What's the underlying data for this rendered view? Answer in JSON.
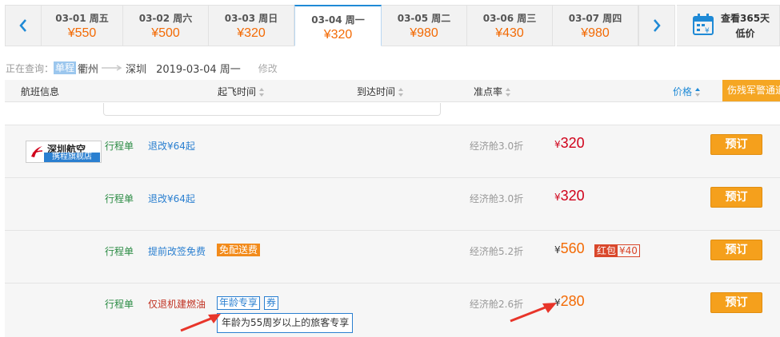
{
  "date_bar": {
    "days": [
      {
        "date": "03-01 周五",
        "price": "¥550"
      },
      {
        "date": "03-02 周六",
        "price": "¥500"
      },
      {
        "date": "03-03 周日",
        "price": "¥320"
      },
      {
        "date": "03-04 周一",
        "price": "¥320",
        "active": true
      },
      {
        "date": "03-05 周二",
        "price": "¥980"
      },
      {
        "date": "03-06 周三",
        "price": "¥430"
      },
      {
        "date": "03-07 周四",
        "price": "¥980"
      }
    ],
    "calendar_line1": "查看365天",
    "calendar_line2": "低价"
  },
  "query": {
    "label": "正在查询：",
    "trip_type": "单程",
    "from": "衢州",
    "to": "深圳",
    "date": "2019-03-04 周一",
    "modify": "修改"
  },
  "header": {
    "flight_info": "航班信息",
    "depart": "起飞时间",
    "arrive": "到达时间",
    "ontime": "准点率",
    "price": "价格",
    "notice": "伤残军警通道"
  },
  "airline": {
    "name": "深圳航空",
    "store": "携程旗舰店"
  },
  "rows": [
    {
      "itinerary": "行程单",
      "policy": "退改¥64起",
      "cabin": "经济舱3.0折",
      "currency": "¥",
      "price": "320",
      "book": "预订"
    },
    {
      "itinerary": "行程单",
      "policy": "退改¥64起",
      "cabin": "经济舱3.0折",
      "currency": "¥",
      "price": "320",
      "book": "预订"
    },
    {
      "itinerary": "行程单",
      "policy": "提前改签免费",
      "badge": "免配送费",
      "cabin": "经济舱5.2折",
      "currency": "¥",
      "price": "560",
      "redpack_label": "红包",
      "redpack_value": "¥40",
      "book": "预订"
    },
    {
      "itinerary": "行程单",
      "policy": "仅退机建燃油",
      "tag1": "年龄专享",
      "tag2": "券",
      "tip": "年龄为55周岁以上的旅客专享",
      "cabin": "经济舱2.6折",
      "currency": "¥",
      "price": "280",
      "book": "预订"
    }
  ],
  "colors": {
    "accent_blue": "#1f8ad6",
    "price_orange": "#f36a04",
    "price_red": "#d0021b",
    "book_button": "#f5a01c",
    "annotation_arrow": "#e8352a"
  }
}
